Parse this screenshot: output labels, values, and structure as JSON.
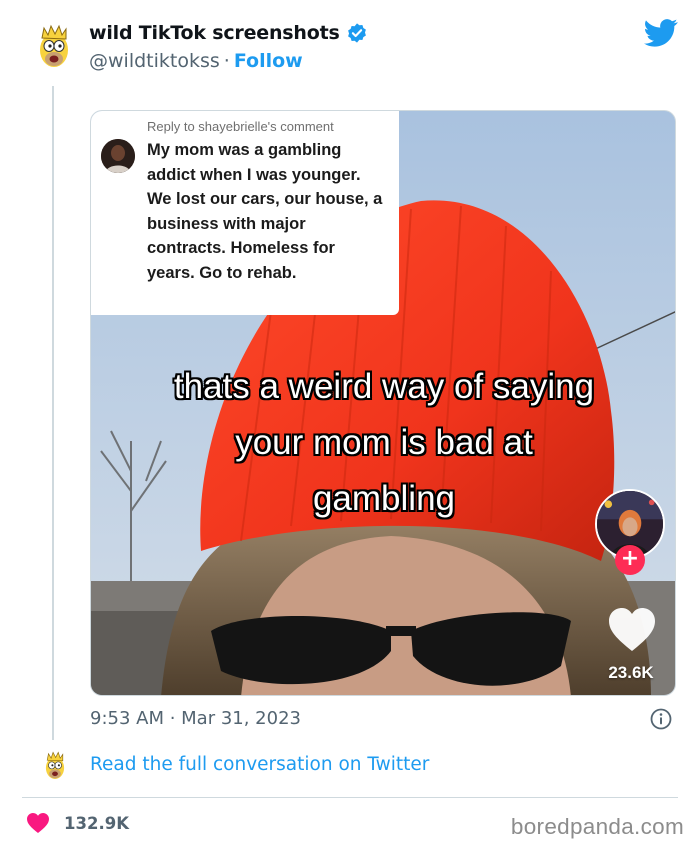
{
  "tweet": {
    "display_name": "wild TikTok screenshots",
    "handle": "@wildtiktokss",
    "separator": "·",
    "follow_label": "Follow",
    "timestamp": "9:53 AM · Mar 31, 2023",
    "read_more": "Read the full conversation on Twitter",
    "likes": "132.9K",
    "icons": {
      "verified": "verified-badge-icon",
      "twitter": "twitter-bird-icon",
      "info": "info-icon",
      "heart": "heart-icon"
    },
    "colors": {
      "accent": "#1d9bf0",
      "heart": "#f91880",
      "muted": "#536471"
    }
  },
  "media": {
    "reply_to": "Reply to shayebrielle's comment",
    "reply_text": "My mom was a gambling addict when I was younger. We lost our cars, our house, a business with major contracts. Homeless for years. Go to rehab.",
    "caption_lines": [
      "thats a weird way of saying",
      "your mom is bad at",
      "gambling"
    ],
    "plus_label": "+",
    "like_count": "23.6K",
    "colors": {
      "beanie": "#f0341c",
      "sky": "#b8cde4",
      "follow_plus": "#fe2c55"
    }
  },
  "watermark": "boredpanda.com"
}
